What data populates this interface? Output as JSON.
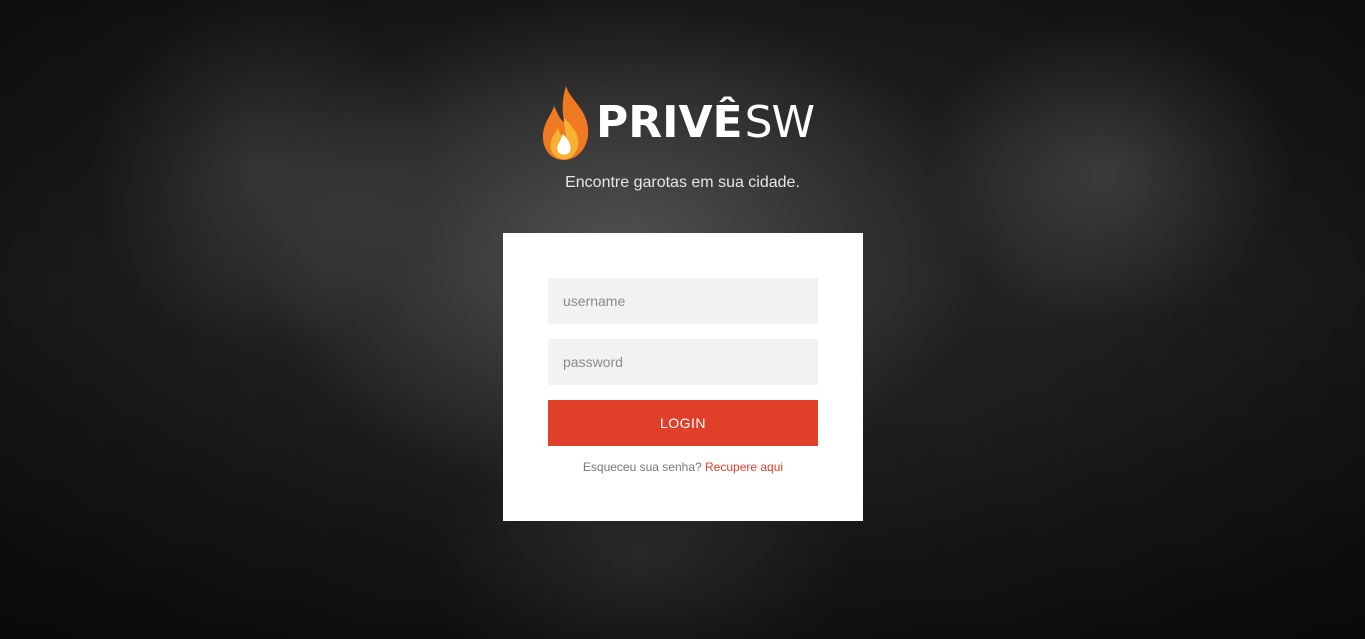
{
  "brand": {
    "name_bold": "PRIVÊ",
    "name_light": "SW",
    "logo_icon": "flame-icon",
    "colors": {
      "flame_outer": "#f07a22",
      "flame_inner": "#f6b233",
      "flame_core": "#ffffff"
    }
  },
  "tagline": "Encontre garotas em sua cidade.",
  "login_form": {
    "username_placeholder": "username",
    "password_placeholder": "password",
    "login_label": "LOGIN",
    "forgot_text": "Esqueceu sua senha?",
    "recover_link": "Recupere aqui",
    "accent_color": "#e0402a"
  }
}
